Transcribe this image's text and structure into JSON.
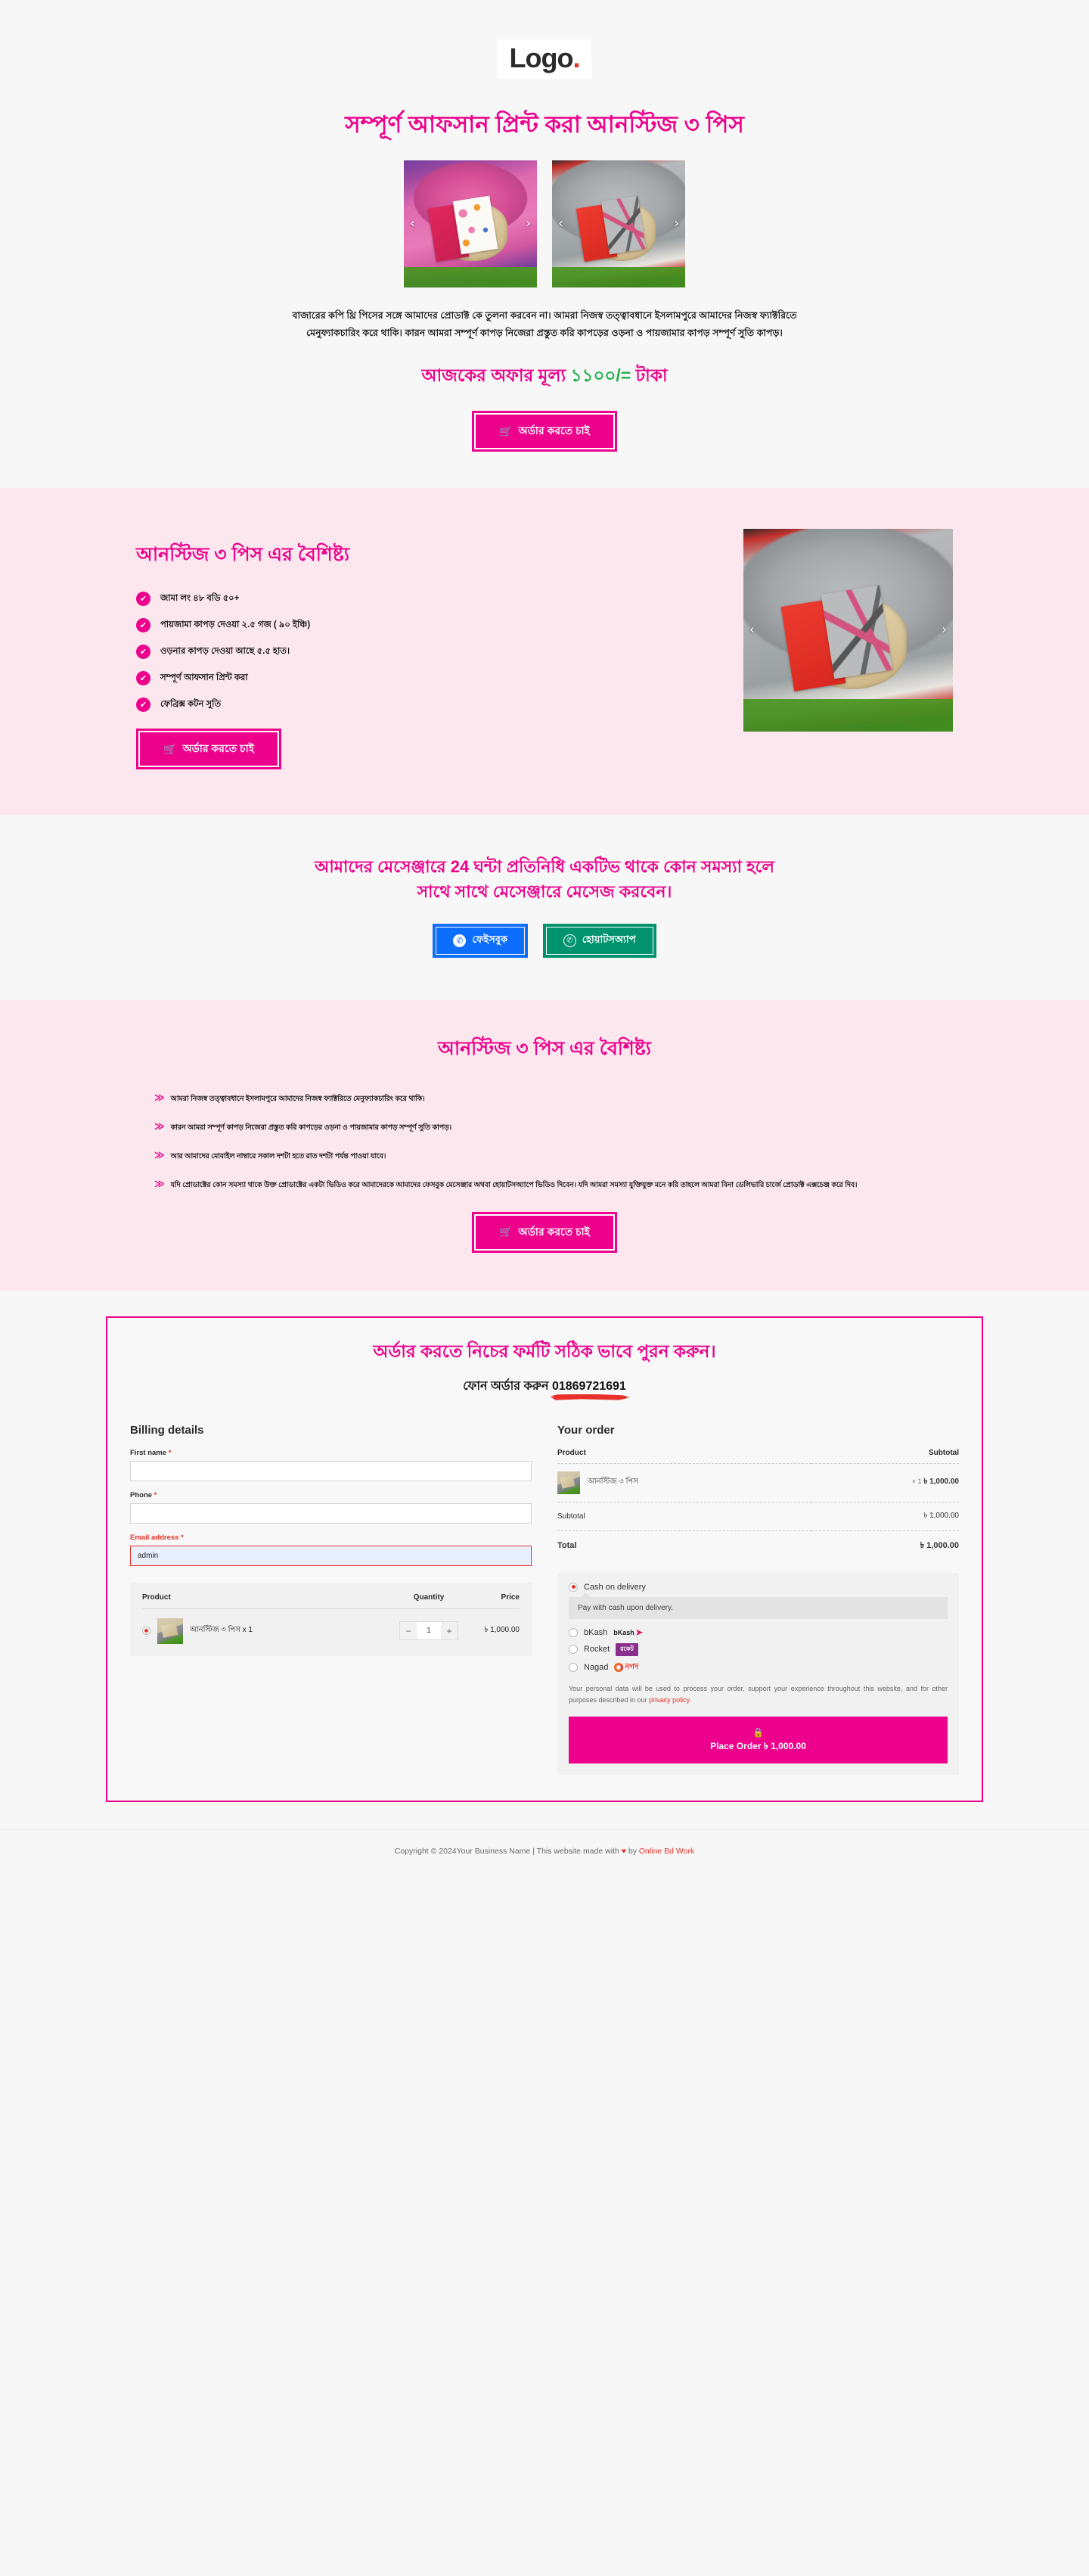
{
  "header": {
    "logo_text": "Logo",
    "logo_dot": "."
  },
  "hero": {
    "title": "সম্পূর্ণ আফসান প্রিন্ট করা আনস্টিজ ৩ পিস",
    "prev_arrow": "‹",
    "next_arrow": "›",
    "description": "বাজারের কপি থ্রি পিসের সঙ্গে আমাদের প্রোডাক্ট কে তুলনা করবেন না। আমরা নিজস্ব তত্ত্বাবধানে ইসলামপুরে আমাদের নিজস্ব ফ্যাক্টরিতে মেনুফ্যাকচারিং করে থাকি। কারন আমরা সম্পূর্ণ কাপড় নিজেরা প্রস্তুত করি কাপড়ের ওড়না ও পায়জামার কাপড় সম্পূর্ণ সুতি কাপড়।",
    "price_label": "আজকের অফার মূল্য",
    "price_amount": "১১০০/=",
    "price_currency": "টাকা",
    "order_button": "অর্ডার করতে চাই",
    "cart_icon": "🛒"
  },
  "features": {
    "title": "আনস্টিজ ৩ পিস এর বৈশিষ্ট্য",
    "check_icon": "✔",
    "items": [
      "জামা লং ৪৮ বডি ৫০+",
      "পায়জামা কাপড় দেওয়া ২.৫ গজ ( ৯০ ইঞ্চি)",
      "ওড়নার কাপড় দেওয়া আছে ৫.৫ হাত।",
      "সম্পূর্ণ আফসান প্রিন্ট করা",
      "ফেব্রিক্স কটন সুতি"
    ],
    "order_button": "অর্ডার করতে চাই"
  },
  "messenger": {
    "title": "আমাদের মেসেঞ্জারে 24 ঘন্টা প্রতিনিধি একটিভ থাকে কোন সমস্যা হলে সাথে সাথে মেসেঞ্জারে মেসেজ করবেন।",
    "facebook_label": "ফেইসবুক",
    "facebook_icon": "✆",
    "whatsapp_label": "হোয়াটসঅ্যাপ",
    "whatsapp_icon": "✆"
  },
  "features2": {
    "title": "আনস্টিজ ৩ পিস এর বৈশিষ্ট্য",
    "check_icon": "≫",
    "items": [
      "আমরা নিজস্ব তত্ত্বাবধানে ইসলামপুরে আমাদের নিজস্ব ফ্যাক্টরিতে মেনুফ্যাকচারিং করে থাকি।",
      "কারন আমরা সম্পূর্ণ কাপড় নিজেরা প্রস্তুত করি কাপড়ের ওড়না ও পায়জামার কাপড় সম্পূর্ণ সুতি কাপড়।",
      "আর আমাদের মোবাইল নাম্বারে সকাল দশটা হতে রাত দশটা পর্যন্ত পাওয়া যাবে।",
      "যদি প্রোডাক্টের কোন সমস্যা থাকে উক্ত প্রোডাক্টের একটা ভিডিও করে আমাদেরকে আমাদের ফেসবুক মেসেঞ্জার অথবা হোয়াটসঅ্যাপে ভিডিও দিবেন। যদি আমরা সমস্যা যুক্তিযুক্ত মনে করি তাহলে আমরা বিনা ডেলিভারি চার্জে প্রোডাক্ট এক্সচেঞ্জ করে দিব।"
    ],
    "order_button": "অর্ডার করতে চাই"
  },
  "checkout": {
    "title": "অর্ডার করতে নিচের ফর্মটি সঠিক ভাবে পুরন করুন।",
    "phone_prefix": "ফোন অর্ডার করুন",
    "phone_number": "01869721691",
    "billing": {
      "heading": "Billing details",
      "fields": [
        {
          "label": "First name",
          "required": "*",
          "value": "",
          "error": false
        },
        {
          "label": "Phone",
          "required": "*",
          "value": "",
          "error": false
        },
        {
          "label": "Email address",
          "required": "*",
          "value": "admin",
          "error": true
        }
      ]
    },
    "cart": {
      "columns": [
        "Product",
        "Quantity",
        "Price"
      ],
      "row": {
        "name": "আনস্টিজ ৩ পিস x 1",
        "qty_minus": "−",
        "qty_value": "1",
        "qty_plus": "+",
        "price": "৳ 1,000.00"
      }
    },
    "order": {
      "heading": "Your order",
      "col_product": "Product",
      "col_subtotal": "Subtotal",
      "item_name": "আনস্টিজ ৩ পিস",
      "item_qty": "× 1",
      "item_subtotal": "৳ 1,000.00",
      "subtotal_label": "Subtotal",
      "subtotal_value": "৳ 1,000.00",
      "total_label": "Total",
      "total_value": "৳ 1,000.00"
    },
    "payment": {
      "cod_label": "Cash on delivery",
      "cod_note": "Pay with cash upon delivery.",
      "bkash_label": "bKash",
      "bkash_logo": "bKash",
      "rocket_label": "Rocket",
      "rocket_logo": "রকেট",
      "nagad_label": "Nagad",
      "nagad_logo": "নগদ"
    },
    "privacy_text": "Your personal data will be used to process your order, support your experience throughout this website, and for other purposes described in our ",
    "privacy_link": "privacy policy",
    "privacy_end": ".",
    "place_order_label": "Place Order",
    "place_order_amount": "৳ 1,000.00",
    "lock_icon": "🔒"
  },
  "footer": {
    "copyright": "Copyright © 2024Your Business Name | This website made with ",
    "heart": "♥",
    "by": " by ",
    "company": "Online Bd Work"
  },
  "colors": {
    "brand_pink": "#ec008c",
    "price_green": "#22b14c",
    "facebook_blue": "#0d6efd",
    "whatsapp_green": "#00936e",
    "error_red": "#e8312a",
    "section_pink_bg": "#fce7ef",
    "page_bg": "#f7f7f7"
  }
}
